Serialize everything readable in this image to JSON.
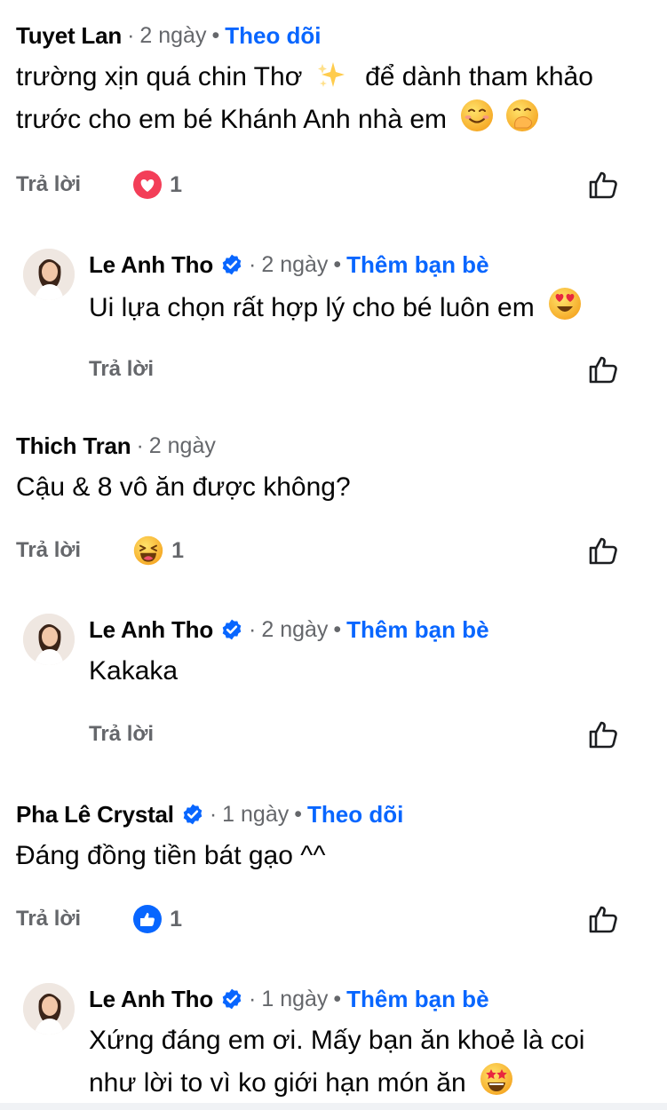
{
  "labels": {
    "reply": "Trả lời"
  },
  "comments": [
    {
      "author": "Tuyet Lan",
      "sep": "·",
      "time": "2 ngày",
      "dot": "•",
      "action": "Theo dõi",
      "line1": "trường xịn quá chin Thơ",
      "line1b": "để dành tham khảo",
      "line2": "trước cho em bé Khánh Anh nhà em",
      "reaction": "love",
      "reaction_count": "1"
    },
    {
      "author": "Le Anh Tho",
      "verified": true,
      "sep": "·",
      "time": "2 ngày",
      "dot": "•",
      "action": "Thêm bạn bè",
      "line1": "Ui lựa chọn rất hợp lý cho bé luôn em"
    },
    {
      "author": "Thich Tran",
      "sep": "·",
      "time": "2 ngày",
      "line1": "Cậu & 8 vô ăn được không?",
      "reaction": "haha",
      "reaction_count": "1"
    },
    {
      "author": "Le Anh Tho",
      "verified": true,
      "sep": "·",
      "time": "2 ngày",
      "dot": "•",
      "action": "Thêm bạn bè",
      "line1": "Kakaka"
    },
    {
      "author": "Pha Lê Crystal",
      "verified": true,
      "sep": "·",
      "time": "1 ngày",
      "dot": "•",
      "action": "Theo dõi",
      "line1": "Đáng đồng tiền bát gạo ^^",
      "reaction": "like",
      "reaction_count": "1"
    },
    {
      "author": "Le Anh Tho",
      "verified": true,
      "sep": "·",
      "time": "1 ngày",
      "dot": "•",
      "action": "Thêm bạn bè",
      "line1": "Xứng đáng em ơi. Mấy bạn ăn khoẻ là coi",
      "line2": "như lời to vì ko giới hạn món ăn"
    }
  ],
  "colors": {
    "link": "#0866ff",
    "meta": "#65676b",
    "text": "#050505",
    "love": "#f33e58",
    "verified": "#0866ff"
  },
  "icons": [
    "verified-badge-icon",
    "sparkles-emoji-icon",
    "smiling-face-emoji-icon",
    "hand-over-mouth-emoji-icon",
    "heart-eyes-emoji-icon",
    "grinning-emoji-icon",
    "star-struck-emoji-icon",
    "love-reaction-icon",
    "haha-reaction-icon",
    "like-reaction-icon",
    "thumbs-up-outline-icon"
  ]
}
